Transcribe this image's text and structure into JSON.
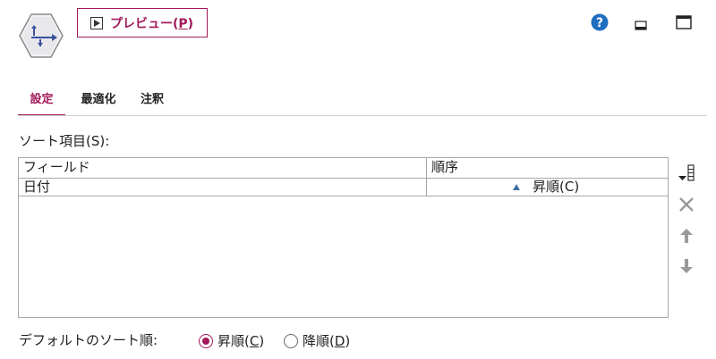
{
  "header": {
    "node_icon": "sort-node-icon",
    "preview_label_prefix": "プレビュー(",
    "preview_label_key": "P",
    "preview_label_suffix": ")",
    "help_icon": "help-icon",
    "minimize_icon": "minimize-icon",
    "maximize_icon": "maximize-icon"
  },
  "tabs": [
    {
      "label": "設定",
      "active": true
    },
    {
      "label": "最適化",
      "active": false
    },
    {
      "label": "注釈",
      "active": false
    }
  ],
  "sort": {
    "section_label": "ソート項目(S):",
    "columns": [
      "フィールド",
      "順序"
    ],
    "rows": [
      {
        "field": "日付",
        "order": "昇順(C)",
        "order_icon": "ascending-triangle-icon"
      }
    ]
  },
  "tools": [
    "add-field-icon",
    "delete-icon",
    "move-up-icon",
    "move-down-icon"
  ],
  "default_sort": {
    "label": "デフォルトのソート順:",
    "options": [
      {
        "prefix": "昇順(",
        "key": "C",
        "suffix": ")",
        "checked": true
      },
      {
        "prefix": "降順(",
        "key": "D",
        "suffix": ")",
        "checked": false
      }
    ]
  },
  "colors": {
    "accent": "#a3195b",
    "help_blue": "#1f6ebf",
    "node_blue": "#3a4fa0"
  }
}
